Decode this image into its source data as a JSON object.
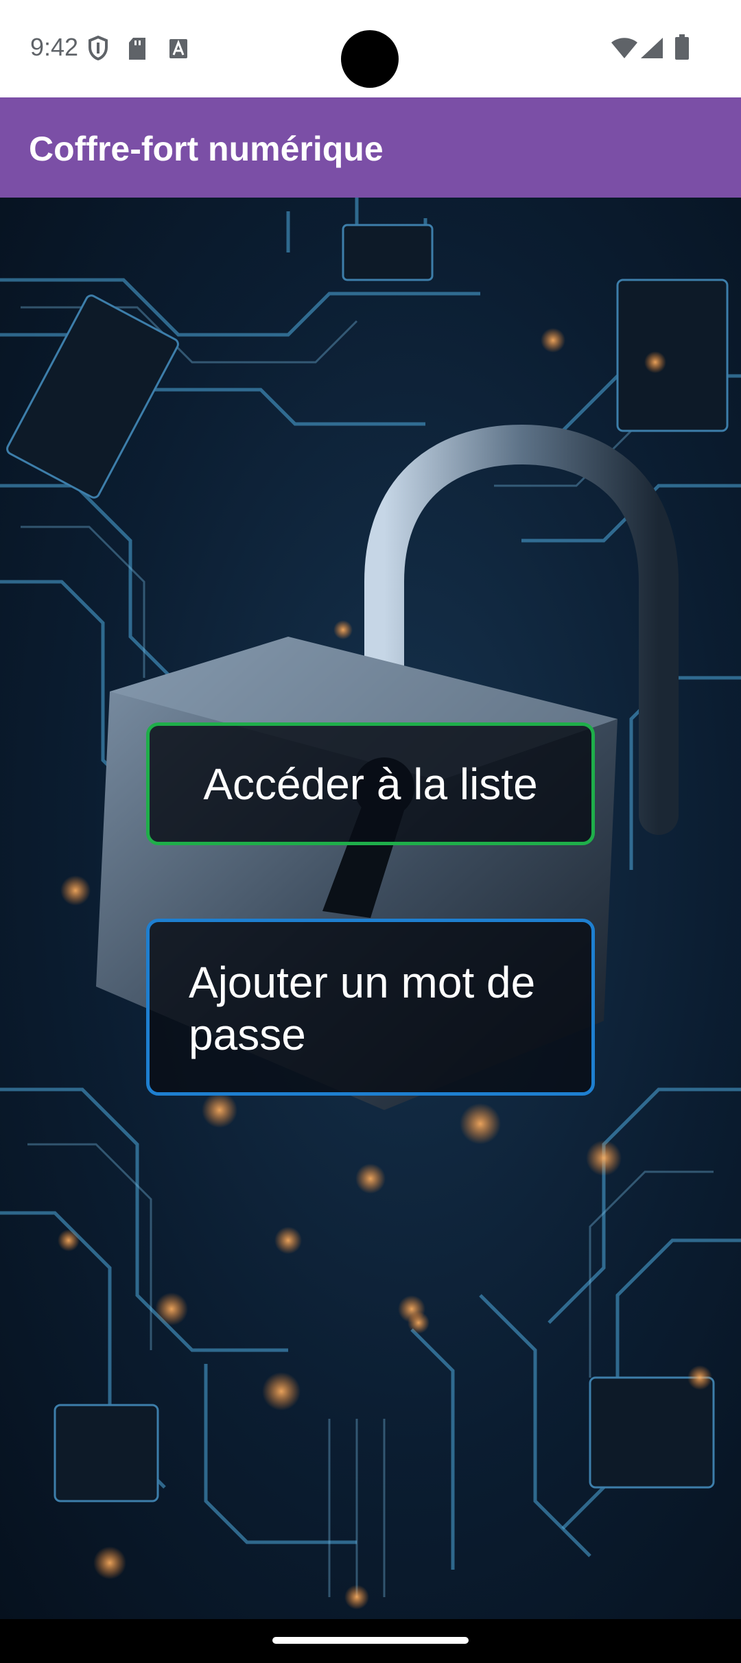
{
  "status_bar": {
    "time": "9:42"
  },
  "app_bar": {
    "title": "Coffre-fort numérique"
  },
  "buttons": {
    "list_label": "Accéder à la liste",
    "add_label": "Ajouter un mot de passe"
  },
  "colors": {
    "app_bar": "#7b4fa6",
    "list_border": "#1fae4a",
    "add_border": "#1e7fd0",
    "button_bg": "#080e16"
  },
  "icons": {
    "status": [
      "shield-icon",
      "sd-card-icon",
      "font-a-icon",
      "wifi-icon",
      "signal-icon",
      "battery-icon"
    ],
    "background": "padlock-circuit-board-image"
  }
}
